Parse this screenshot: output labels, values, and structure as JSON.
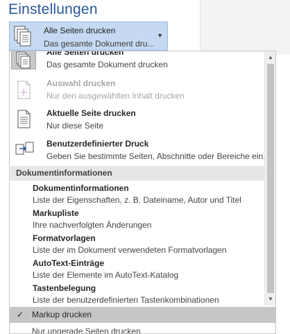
{
  "header": {
    "title": "Einstellungen"
  },
  "print_range": {
    "selected_title": "Alle Seiten drucken",
    "selected_sub": "Das gesamte Dokument dru..."
  },
  "menu": {
    "items": [
      {
        "title": "Alle Seiten drucken",
        "subtitle": "Das gesamte Dokument drucken",
        "icon": "all-pages-icon",
        "enabled": true
      },
      {
        "title": "Auswahl drucken",
        "subtitle": "Nur den ausgewählten Inhalt drucken",
        "icon": "selection-icon",
        "enabled": false
      },
      {
        "title": "Aktuelle Seite drucken",
        "subtitle": "Nur diese Seite",
        "icon": "current-page-icon",
        "enabled": true
      },
      {
        "title": "Benutzerdefinierter Druck",
        "subtitle": "Geben Sie bestimmte Seiten, Abschnitte oder Bereiche ein.",
        "icon": "custom-print-icon",
        "enabled": true
      }
    ],
    "group_header": "Dokumentinformationen",
    "doc_items": [
      {
        "title": "Dokumentinformationen",
        "subtitle": "Liste der Eigenschaften, z. B. Dateiname, Autor und Titel"
      },
      {
        "title": "Markupliste",
        "subtitle": "Ihre nachverfolgten Änderungen"
      },
      {
        "title": "Formatvorlagen",
        "subtitle": "Liste der im Dokument verwendeten Formatvorlagen"
      },
      {
        "title": "AutoText-Einträge",
        "subtitle": "Liste der Elemente im AutoText-Katalog"
      },
      {
        "title": "Tastenbelegung",
        "subtitle": "Liste der benutzerdefinierten Tastenkombinationen"
      }
    ],
    "markup_check": "✓",
    "markup_label": "Markup drucken",
    "odd_pages": "Nur ungerade Seiten drucken"
  },
  "colors": {
    "accent": "#2b579a",
    "dropdown_bg": "#c5daf2",
    "selected_row": "#c6c6c6"
  }
}
